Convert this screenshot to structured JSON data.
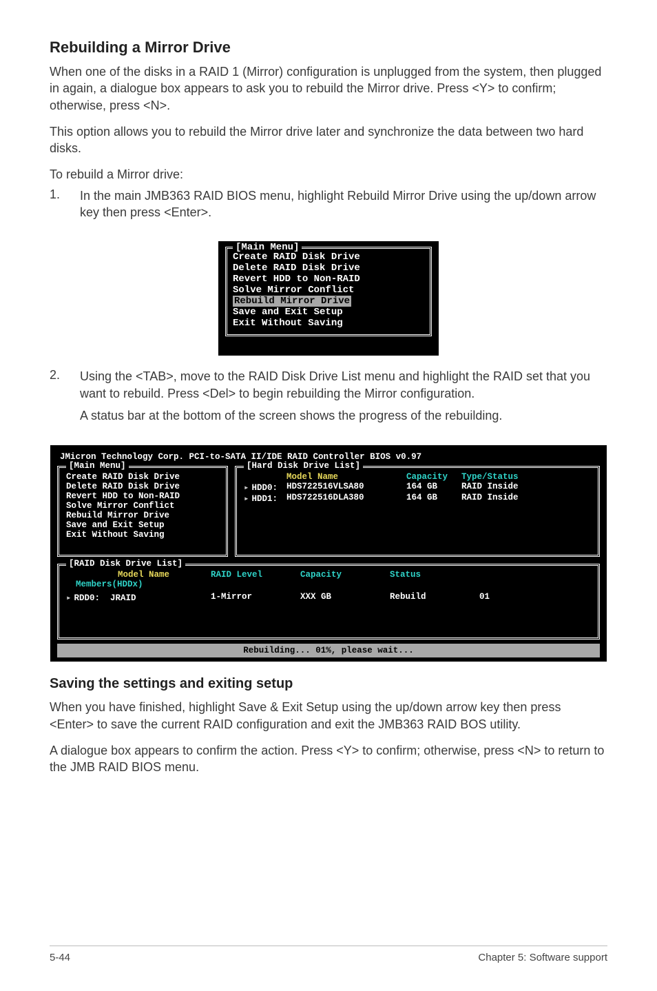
{
  "section1": {
    "title": "Rebuilding a Mirror Drive",
    "para1": "When one of the disks in a RAID 1 (Mirror) configuration is unplugged from the system, then plugged in again, a dialogue box appears to ask you to rebuild the Mirror drive. Press <Y> to confirm; otherwise, press <N>.",
    "para2": "This option allows you to rebuild the Mirror drive later and synchronize the data between two hard disks.",
    "para3": "To rebuild a Mirror drive:",
    "step1_num": "1.",
    "step1_text": "In the main JMB363 RAID BIOS menu, highlight Rebuild Mirror Drive using the up/down arrow key then press <Enter>.",
    "step2_num": "2.",
    "step2_text": "Using the <TAB>, move to the RAID Disk Drive List menu and highlight the RAID set that you want to rebuild. Press <Del> to begin rebuilding the Mirror configuration.",
    "step2_sub": "A status bar at the bottom of the screen shows the progress of the rebuilding."
  },
  "bios_small": {
    "legend": "[Main Menu]",
    "items": [
      "Create RAID Disk Drive",
      "Delete RAID Disk Drive",
      "Revert HDD to Non-RAID",
      "Solve Mirror Conflict",
      "Rebuild Mirror Drive",
      "Save and Exit Setup",
      "Exit Without Saving"
    ],
    "highlight_index": 4
  },
  "bios_large": {
    "header": "JMicron Technology Corp. PCI-to-SATA II/IDE RAID Controller BIOS v0.97",
    "main_legend": "[Main Menu]",
    "main_items": [
      "Create RAID Disk Drive",
      "Delete RAID Disk Drive",
      "Revert HDD to Non-RAID",
      "Solve Mirror Conflict",
      "Rebuild Mirror Drive",
      "Save and Exit Setup",
      "Exit Without Saving"
    ],
    "hd_legend": "[Hard Disk Drive List]",
    "hd_head": {
      "c1": "",
      "c2": "Model Name",
      "c3": "Capacity",
      "c4": "Type/Status"
    },
    "hd_rows": [
      {
        "c1": "HDD0:",
        "c2": "HDS722516VLSA80",
        "c3": "164 GB",
        "c4": "RAID Inside"
      },
      {
        "c1": "HDD1:",
        "c2": "HDS722516DLA380",
        "c3": "164 GB",
        "c4": "RAID Inside"
      }
    ],
    "rd_legend": "[RAID Disk Drive List]",
    "rd_head": {
      "c1": "          Model Name",
      "c2": "RAID Level",
      "c3": "Capacity",
      "c4": "Status",
      "c5": ""
    },
    "rd_members": "Members(HDDx)",
    "rd_row": {
      "c1": "RDD0:  JRAID",
      "c2": "1-Mirror",
      "c3": "XXX GB",
      "c4": "Rebuild",
      "c5": "01"
    },
    "status": "Rebuilding... 01%, please wait..."
  },
  "section2": {
    "title": "Saving the settings and exiting setup",
    "para1": "When you have finished, highlight Save & Exit Setup using the up/down arrow key then press <Enter> to save the current RAID configuration and exit the JMB363 RAID BOS utility.",
    "para2": "A dialogue box appears to confirm the action. Press <Y> to confirm; otherwise, press <N> to return to the JMB RAID BIOS menu."
  },
  "footer": {
    "left": "5-44",
    "right": "Chapter 5: Software support"
  }
}
